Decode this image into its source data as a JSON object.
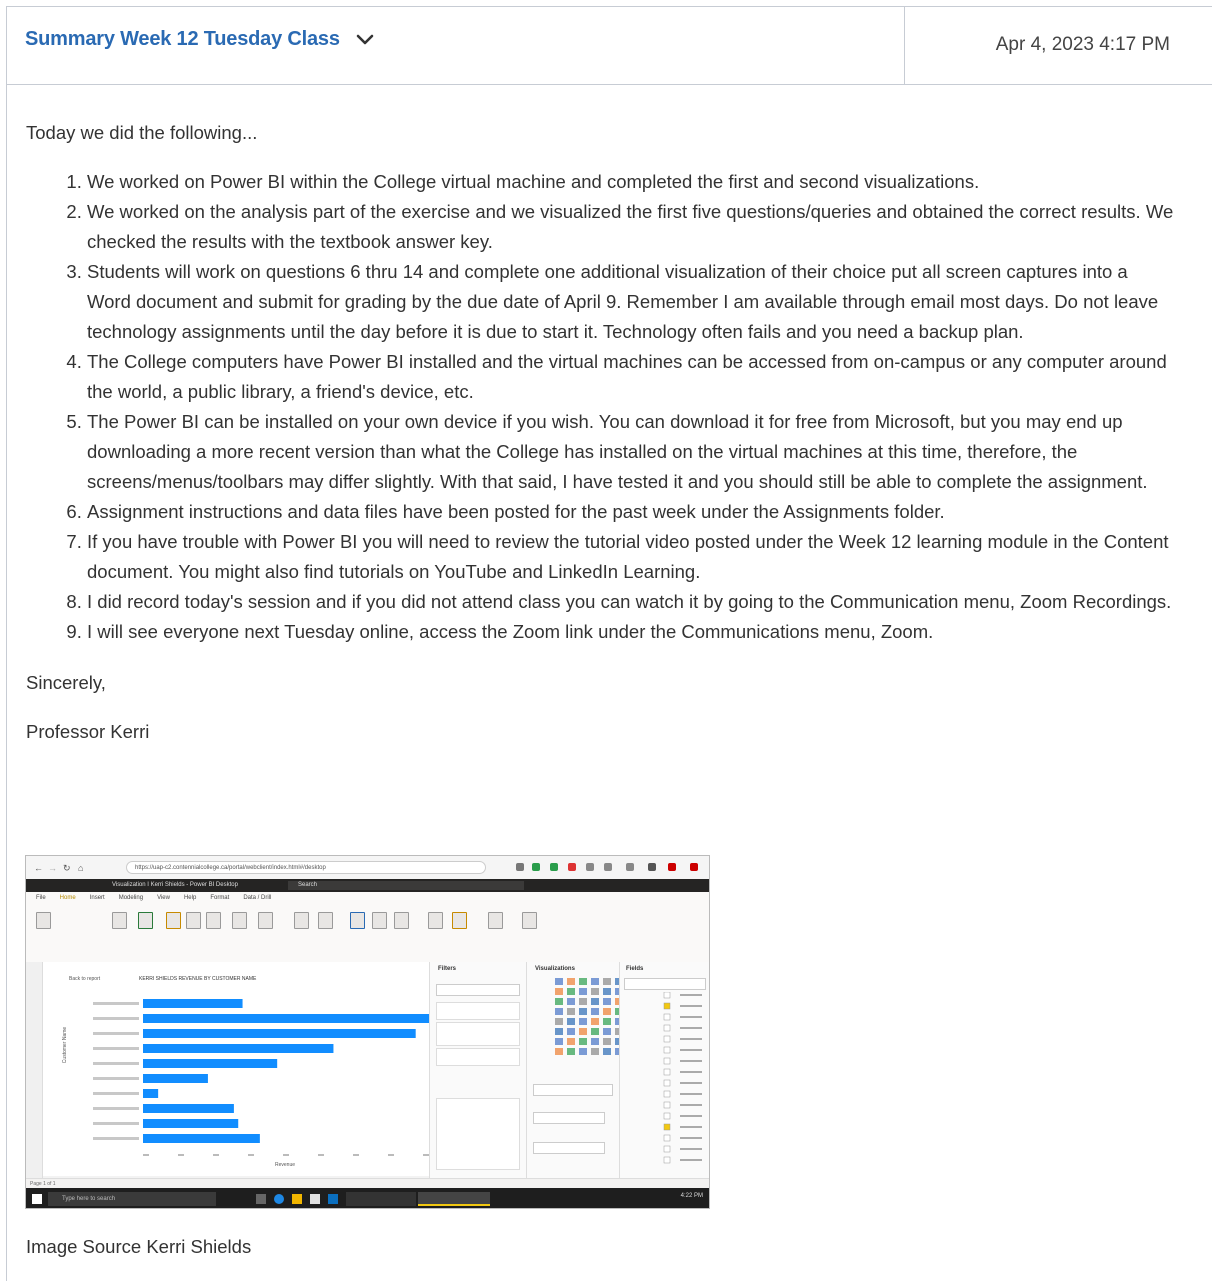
{
  "header": {
    "title": "Summary Week 12 Tuesday Class",
    "date": "Apr 4, 2023 4:17 PM"
  },
  "body": {
    "intro": "Today we did the following...",
    "items": [
      "We worked on Power BI within the College virtual machine and completed the first and second visualizations.",
      "We worked on the analysis part of the exercise and we visualized the first five questions/queries and obtained the correct results. We checked the results with the textbook answer key.",
      "Students will work on questions 6 thru 14 and complete one additional visualization of their choice put all screen captures into a Word document and submit for grading by the due date of April 9.  Remember I am available through email most days. Do not leave technology assignments until the day before it is due to start it.  Technology often fails and you need a backup plan.",
      "The College computers have Power BI installed and the virtual machines can be accessed from on-campus or any computer around the world, a public library, a friend's device, etc.",
      "The Power BI can be installed on your own device if you wish. You can download it for free from Microsoft, but you may end up downloading a more recent version than what the College has installed on the virtual machines at this time, therefore, the screens/menus/toolbars may differ slightly.  With that said, I have tested it and you should still be able to complete the assignment.",
      "Assignment instructions and data files have been posted for the past week under the Assignments folder.",
      "If you have trouble with Power BI you will need to review the tutorial video posted under the Week 12 learning module in the Content document.  You might also find tutorials on YouTube and LinkedIn Learning.",
      "I did record today's session and if you did not attend class you can watch it by going to the Communication menu, Zoom Recordings.",
      "I will see everyone next Tuesday online, access the Zoom link under the Communications menu, Zoom."
    ],
    "closing": "Sincerely,",
    "signature": "Professor Kerri",
    "image_source": "Image Source Kerri Shields"
  },
  "screenshot": {
    "address": "https://uap-c2.contennialcollege.ca/portal/webclient/index.html#/desktop",
    "window_title": "Visualization I Kerri Shields - Power BI Desktop",
    "search": "Search",
    "ribbon_tabs": [
      "File",
      "Home",
      "Insert",
      "Modeling",
      "View",
      "Help",
      "Format",
      "Data / Drill"
    ],
    "back_label": "Back to report",
    "chart_title": "KERRI SHIELDS REVENUE BY CUSTOMER NAME",
    "axis_label": "Revenue",
    "y_axis_label": "Customer Name",
    "bars": [
      0.23,
      0.67,
      0.63,
      0.44,
      0.31,
      0.15,
      0.035,
      0.21,
      0.22,
      0.27
    ],
    "filters_label": "Filters",
    "visualizations_label": "Visualizations",
    "fields_label": "Fields",
    "page_label": "Page 1 of 1",
    "taskbar_search": "Type here to search",
    "time": "4:22 PM"
  }
}
